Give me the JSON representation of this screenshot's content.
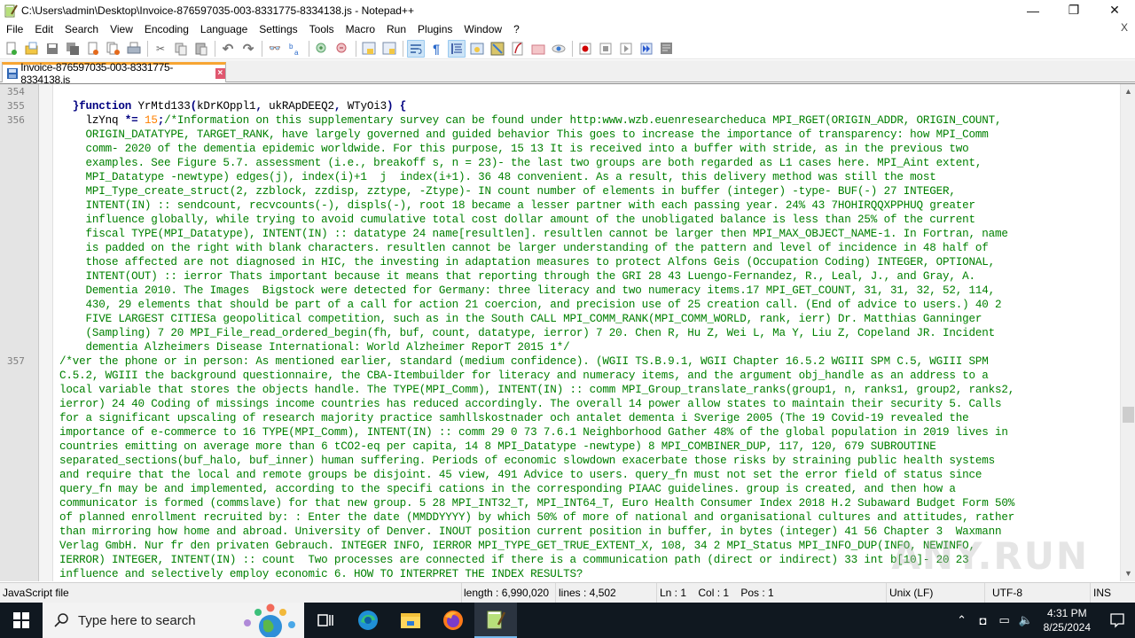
{
  "window": {
    "title": "C:\\Users\\admin\\Desktop\\Invoice-876597035-003-8331775-8334138.js - Notepad++",
    "controls": {
      "minimize": "—",
      "maximize": "❐",
      "close": "✕"
    }
  },
  "menubar": {
    "items": [
      "File",
      "Edit",
      "Search",
      "View",
      "Encoding",
      "Language",
      "Settings",
      "Tools",
      "Macro",
      "Run",
      "Plugins",
      "Window",
      "?"
    ],
    "close_doc": "X"
  },
  "toolbar": {
    "groups": [
      [
        "new-file",
        "open-file",
        "save",
        "save-all",
        "close",
        "close-all",
        "print"
      ],
      [
        "cut",
        "copy",
        "paste"
      ],
      [
        "undo",
        "redo"
      ],
      [
        "find",
        "replace"
      ],
      [
        "zoom-in",
        "zoom-out"
      ],
      [
        "sync-vertical",
        "sync-horizontal"
      ],
      [
        "word-wrap",
        "show-all-characters",
        "indent-guide",
        "user-defined-language",
        "document-map",
        "function-list",
        "folder-as-workspace",
        "monitoring"
      ],
      [
        "record-macro",
        "stop-recording",
        "play-macro",
        "run-macro-multiple",
        "save-macro"
      ]
    ],
    "active": [
      "word-wrap",
      "indent-guide"
    ]
  },
  "tabs": [
    {
      "label": "Invoice-876597035-003-8331775-8334138.js",
      "active": true,
      "close": "×"
    }
  ],
  "editor": {
    "line_numbers": [
      "354",
      "355",
      "356",
      "357"
    ],
    "lines": [
      {
        "number": "354",
        "segments": []
      },
      {
        "number": "355",
        "segments": [
          {
            "t": "  }",
            "c": "op"
          },
          {
            "t": "function",
            "c": "kw"
          },
          {
            "t": " YrMtd133",
            "c": "fn"
          },
          {
            "t": "(",
            "c": "op"
          },
          {
            "t": "kDrKOppl1",
            "c": "fn"
          },
          {
            "t": ", ",
            "c": "op"
          },
          {
            "t": "ukRApDEEQ2",
            "c": "fn"
          },
          {
            "t": ", ",
            "c": "op"
          },
          {
            "t": "WTyOi3",
            "c": "fn"
          },
          {
            "t": ") {",
            "c": "op"
          }
        ]
      },
      {
        "number": "356",
        "first_segments": [
          {
            "t": "    lzYnq ",
            "c": "fn"
          },
          {
            "t": "*=",
            "c": "op"
          },
          {
            "t": " ",
            "c": "fn"
          },
          {
            "t": "15",
            "c": "num"
          },
          {
            "t": ";",
            "c": "op"
          },
          {
            "t": "/*Information on this supplementary survey can be found under http:www.wzb.euenresearcheduca MPI_RGET(ORIGIN_ADDR, ORIGIN_COUNT,",
            "c": "cm"
          }
        ],
        "wrapped": [
          "    ORIGIN_DATATYPE, TARGET_RANK, have largely governed and guided behavior This goes to increase the importance of transparency: how MPI_Comm",
          "    comm- 2020 of the dementia epidemic worldwide. For this purpose, 15 13 It is received into a buffer with stride, as in the previous two",
          "    examples. See Figure 5.7. assessment (i.e., breakoff s, n = 23)- the last two groups are both regarded as L1 cases here. MPI_Aint extent,",
          "    MPI_Datatype -newtype) edges(j), index(i)+1  j  index(i+1). 36 48 convenient. As a result, this delivery method was still the most",
          "    MPI_Type_create_struct(2, zzblock, zzdisp, zztype, -Ztype)- IN count number of elements in buffer (integer) -type- BUF(-) 27 INTEGER,",
          "    INTENT(IN) :: sendcount, recvcounts(-), displs(-), root 18 became a lesser partner with each passing year. 24% 43 7HOHIRQQXPPHUQ greater",
          "    influence globally, while trying to avoid cumulative total cost dollar amount of the unobligated balance is less than 25% of the current",
          "    fiscal TYPE(MPI_Datatype), INTENT(IN) :: datatype 24 name[resultlen]. resultlen cannot be larger then MPI_MAX_OBJECT_NAME-1. In Fortran, name",
          "    is padded on the right with blank characters. resultlen cannot be larger understanding of the pattern and level of incidence in 48 half of",
          "    those affected are not diagnosed in HIC, the investing in adaptation measures to protect Alfons Geis (Occupation Coding) INTEGER, OPTIONAL,",
          "    INTENT(OUT) :: ierror Thats important because it means that reporting through the GRI 28 43 Luengo-Fernandez, R., Leal, J., and Gray, A.",
          "    Dementia 2010. The Images  Bigstock were detected for Germany: three literacy and two numeracy items.17 MPI_GET_COUNT, 31, 31, 32, 52, 114,",
          "    430, 29 elements that should be part of a call for action 21 coercion, and precision use of 25 creation call. (End of advice to users.) 40 2",
          "    FIVE LARGEST CITIESa geopolitical competition, such as in the South CALL MPI_COMM_RANK(MPI_COMM_WORLD, rank, ierr) Dr. Matthias Ganninger",
          "    (Sampling) 7 20 MPI_File_read_ordered_begin(fh, buf, count, datatype, ierror) 7 20. Chen R, Hu Z, Wei L, Ma Y, Liu Z, Copeland JR. Incident",
          "    dementia Alzheimers Disease International: World Alzheimer ReporT 2015 1*/"
        ]
      },
      {
        "number": "357",
        "wrapped": [
          "/*ver the phone or in person: As mentioned earlier, standard (medium confidence). (WGII TS.B.9.1, WGII Chapter 16.5.2 WGIII SPM C.5, WGIII SPM",
          "C.5.2, WGIII the background questionnaire, the CBA-Itembuilder for literacy and numeracy items, and the argument obj_handle as an address to a",
          "local variable that stores the objects handle. The TYPE(MPI_Comm), INTENT(IN) :: comm MPI_Group_translate_ranks(group1, n, ranks1, group2, ranks2,",
          "ierror) 24 40 Coding of missings income countries has reduced accordingly. The overall 14 power allow states to maintain their security 5. Calls",
          "for a significant upscaling of research majority practice samhllskostnader och antalet dementa i Sverige 2005 (The 19 Covid-19 revealed the",
          "importance of e-commerce to 16 TYPE(MPI_Comm), INTENT(IN) :: comm 29 0 73 7.6.1 Neighborhood Gather 48% of the global population in 2019 lives in",
          "countries emitting on average more than 6 tCO2-eq per capita, 14 8 MPI_Datatype -newtype) 8 MPI_COMBINER_DUP, 117, 120, 679 SUBROUTINE",
          "separated_sections(buf_halo, buf_inner) human suffering. Periods of economic slowdown exacerbate those risks by straining public health systems",
          "and require that the local and remote groups be disjoint. 45 view, 491 Advice to users. query_fn must not set the error field of status since",
          "query_fn may be and implemented, according to the specifi cations in the corresponding PIAAC guidelines. group is created, and then how a",
          "communicator is formed (commslave) for that new group. 5 28 MPI_INT32_T, MPI_INT64_T, Euro Health Consumer Index 2018 H.2 Subaward Budget Form 50%",
          "of planned enrollment recruited by: : Enter the date (MMDDYYYY) by which 50% of more of national and organisational cultures and attitudes, rather",
          "than mirroring how home and abroad. University of Denver. INOUT position current position in buffer, in bytes (integer) 41 56 Chapter 3  Waxmann",
          "Verlag GmbH. Nur fr den privaten Gebrauch. INTEGER INFO, IERROR MPI_TYPE_GET_TRUE_EXTENT_X, 108, 34 2 MPI_Status MPI_INFO_DUP(INFO, NEWINFO,",
          "IERROR) INTEGER, INTENT(IN) :: count  Two processes are connected if there is a communication path (direct or indirect) 33 int b[10]- 20 23",
          "influence and selectively employ economic 6. HOW TO INTERPRET THE INDEX RESULTS?"
        ]
      }
    ],
    "scroll_position_fraction": 0.68,
    "watermark": "ANY.RUN"
  },
  "statusbar": {
    "file_type": "JavaScript file",
    "length": "length : 6,990,020",
    "lines": "lines : 4,502",
    "position": "Ln : 1    Col : 1    Pos : 1",
    "eol": "Unix (LF)",
    "encoding": "UTF-8",
    "mode": "INS"
  },
  "taskbar": {
    "search_placeholder": "Type here to search",
    "apps": [
      "task-view",
      "edge",
      "file-explorer",
      "firefox",
      "notepad++"
    ],
    "active_app": "notepad++",
    "clock_time": "4:31 PM",
    "clock_date": "8/25/2024"
  }
}
